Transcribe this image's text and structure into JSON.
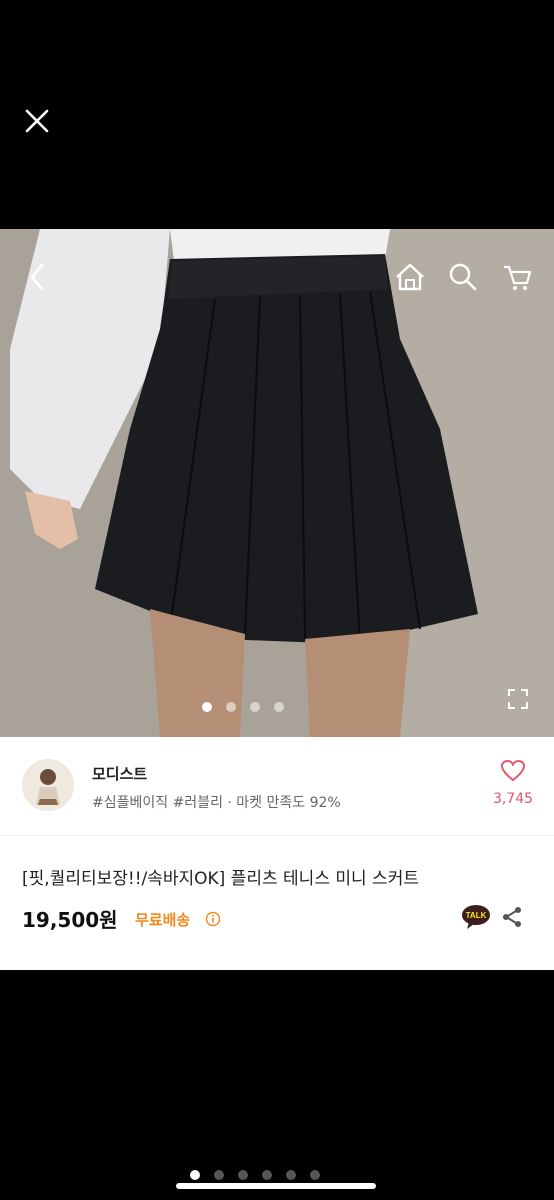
{
  "viewer": {
    "close_icon": "close-icon"
  },
  "image": {
    "nav_icons": [
      "back-icon",
      "home-icon",
      "search-icon",
      "cart-icon"
    ],
    "dots_total": 4,
    "dots_active": 1,
    "expand_icon": "expand-icon"
  },
  "seller": {
    "name": "모디스트",
    "tags": "#심플베이직 #러블리 · 마켓 만족도 92%",
    "likes": "3,745"
  },
  "product": {
    "title": "[핏,퀄리티보장!!/속바지OK] 플리츠 테니스 미니 스커트",
    "price": "19,500원",
    "shipping": "무료배송",
    "talk_label": "TALK"
  },
  "pager": {
    "total": 6,
    "active": 1
  },
  "colors": {
    "like": "#e05a68",
    "shipping": "#f08a1e",
    "talk": "#3c1e1e"
  }
}
